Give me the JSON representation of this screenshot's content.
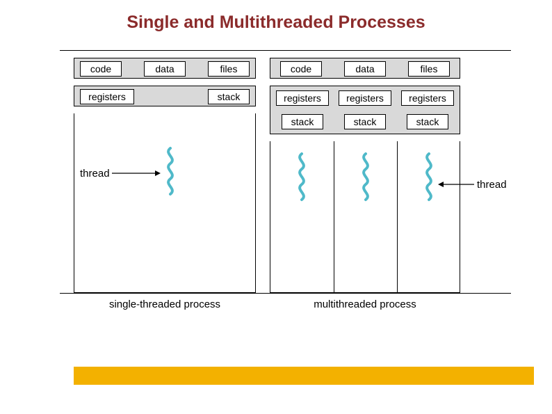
{
  "title": "Single and Multithreaded Processes",
  "shared": {
    "code": "code",
    "data": "data",
    "files": "files"
  },
  "single": {
    "registers": "registers",
    "stack": "stack",
    "thread_label": "thread",
    "caption": "single-threaded process"
  },
  "multi": {
    "registers": "registers",
    "stack": "stack",
    "thread_label": "thread",
    "caption": "multithreaded process"
  }
}
